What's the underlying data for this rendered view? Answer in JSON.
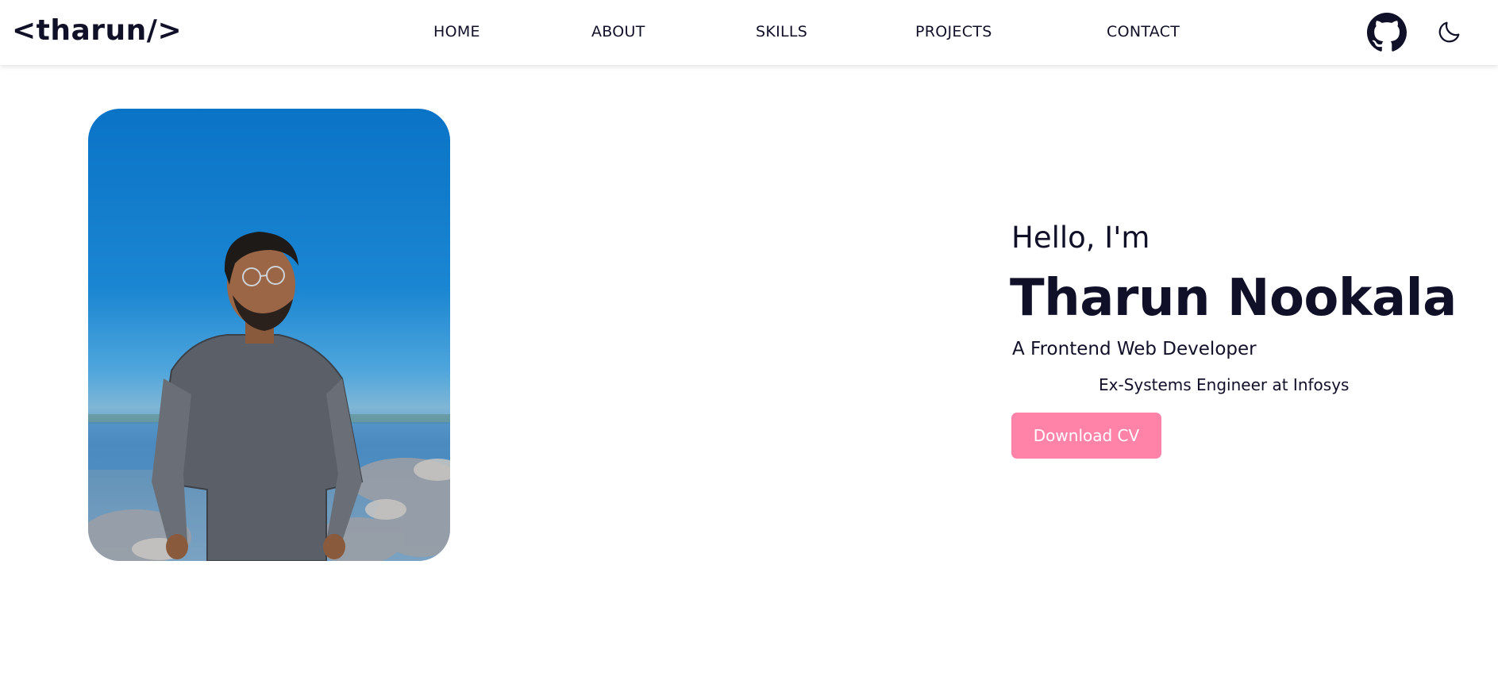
{
  "header": {
    "logo": "<tharun/>",
    "nav": {
      "home": "HOME",
      "about": "ABOUT",
      "skills": "SKILLS",
      "projects": "PROJECTS",
      "contact": "CONTACT"
    },
    "github_icon": "github-icon",
    "theme_icon": "moon-icon"
  },
  "hero": {
    "greeting": "Hello, I'm",
    "name": "Tharun Nookala",
    "role": "A Frontend Web Developer",
    "previous_role": "Ex-Systems Engineer at Infosys",
    "cta_label": "Download CV"
  },
  "colors": {
    "text": "#111029",
    "accent": "#ff82a9",
    "background": "#ffffff"
  }
}
